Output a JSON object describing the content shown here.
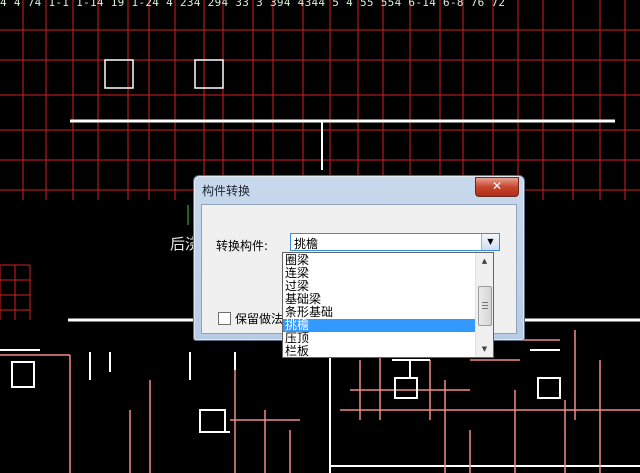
{
  "canvas": {
    "ruler_text": "4 4 74 1-1 1-14 19 1-24 4 234 294 33 3 394 4344 5 4 55 554 6-14 6-8 76 72",
    "label": "后浇",
    "colors": {
      "background": "#000000",
      "grid": "#d41f1f",
      "wall": "#ffffff",
      "beam": "#f08a8a"
    }
  },
  "dialog": {
    "title": "构件转换",
    "close_label": "✕",
    "field_label": "转换构件:",
    "combo_value": "挑檐",
    "checkbox_label": "保留做法"
  },
  "dropdown": {
    "items": [
      "圈梁",
      "连梁",
      "过梁",
      "基础梁",
      "条形基础",
      "挑檐",
      "压顶",
      "栏板"
    ],
    "selected_index": 5
  }
}
